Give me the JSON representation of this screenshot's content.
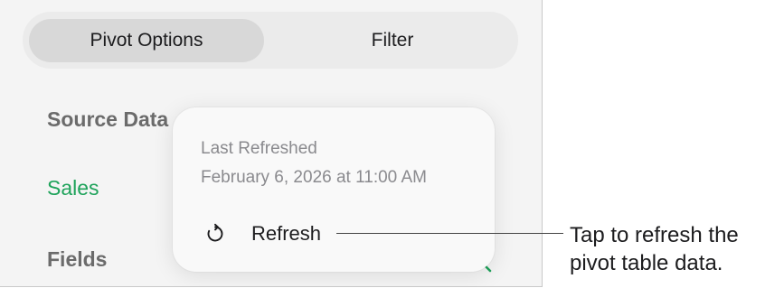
{
  "segmented": {
    "pivot_options_label": "Pivot Options",
    "filter_label": "Filter"
  },
  "sections": {
    "source_data_label": "Source Data",
    "source_value": "Sales",
    "fields_label": "Fields"
  },
  "popover": {
    "last_refreshed_label": "Last Refreshed",
    "last_refreshed_value": "February 6, 2026 at 11:00 AM",
    "refresh_label": "Refresh",
    "refresh_icon": "refresh-icon"
  },
  "callout": {
    "line1": "Tap to refresh the",
    "line2": "pivot table data."
  },
  "colors": {
    "accent_green": "#1fa35b",
    "panel_bg": "#f4f4f4",
    "selected_segment": "#d8d8d8"
  }
}
